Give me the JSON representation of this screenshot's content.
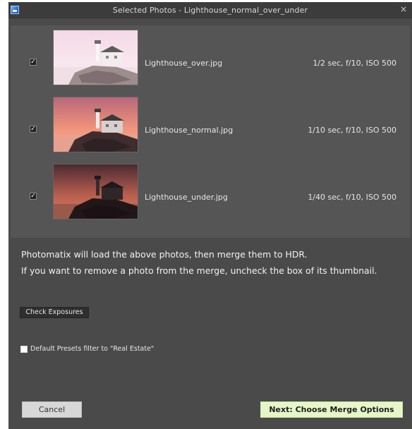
{
  "window": {
    "title": "Selected Photos - Lighthouse_normal_over_under",
    "close_glyph": "×",
    "app_icon": "photomatix-app-icon",
    "close_icon": "close-icon"
  },
  "photos": [
    {
      "checked": true,
      "check_glyph": "✓",
      "filename": "Lighthouse_over.jpg",
      "exposure": "1/2 sec, f/10, ISO 500"
    },
    {
      "checked": true,
      "check_glyph": "✓",
      "filename": "Lighthouse_normal.jpg",
      "exposure": "1/10 sec, f/10, ISO 500"
    },
    {
      "checked": true,
      "check_glyph": "✓",
      "filename": "Lighthouse_under.jpg",
      "exposure": "1/40 sec, f/10, ISO 500"
    }
  ],
  "info": {
    "line1": "Photomatix will load the above photos, then merge them to HDR.",
    "line2": "If you want to remove a photo from the merge, uncheck the box of its thumbnail."
  },
  "buttons": {
    "check_exposures": "Check Exposures",
    "cancel": "Cancel",
    "next": "Next: Choose Merge Options"
  },
  "preset_filter": {
    "checked": false,
    "label": "Default Presets filter to \"Real Estate\""
  },
  "colors": {
    "window_bg": "#4a4a4a",
    "panel_bg": "#555555",
    "next_button_bg": "#e5f6c8",
    "cancel_button_bg": "#d7d7d7"
  }
}
